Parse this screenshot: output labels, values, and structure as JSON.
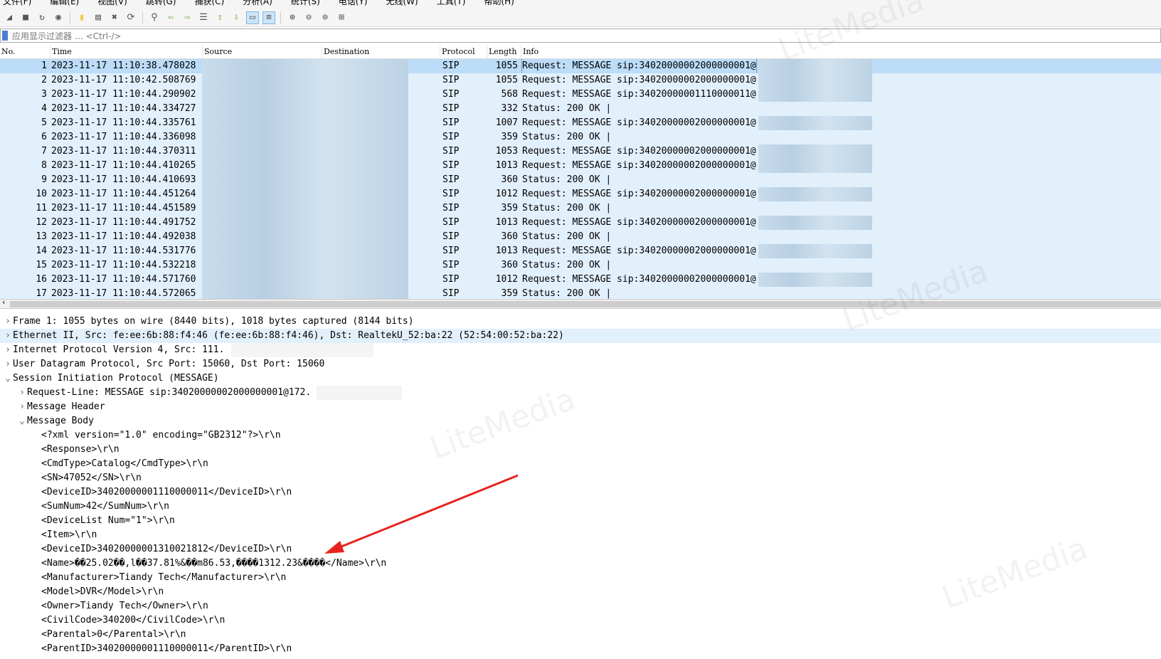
{
  "menu": [
    "文件(F)",
    "编辑(E)",
    "视图(V)",
    "跳转(G)",
    "捕获(C)",
    "分析(A)",
    "统计(S)",
    "电话(Y)",
    "无线(W)",
    "工具(T)",
    "帮助(H)"
  ],
  "toolbar": [
    "shark-fin-icon",
    "stop-icon",
    "restart-icon",
    "options-icon",
    "open-icon",
    "save-icon",
    "close-file-icon",
    "reload-icon",
    "find-icon",
    "back-icon",
    "forward-icon",
    "goto-icon",
    "first-icon",
    "last-icon",
    "autoscroll-icon",
    "colorize-icon",
    "zoom-in-icon",
    "zoom-out-icon",
    "zoom-reset-icon",
    "resize-columns-icon"
  ],
  "filter": {
    "placeholder": "应用显示过滤器 … <Ctrl-/>"
  },
  "columns": [
    "No.",
    "Time",
    "Source",
    "Destination",
    "Protocol",
    "Length",
    "Info"
  ],
  "packets": [
    {
      "no": "1",
      "time": "2023-11-17 11:10:38.478028",
      "proto": "SIP",
      "len": "1055",
      "info": "Request: MESSAGE sip:34020000002000000001@"
    },
    {
      "no": "2",
      "time": "2023-11-17 11:10:42.508769",
      "proto": "SIP",
      "len": "1055",
      "info": "Request: MESSAGE sip:34020000002000000001@"
    },
    {
      "no": "3",
      "time": "2023-11-17 11:10:44.290902",
      "proto": "SIP",
      "len": "568",
      "info": "Request: MESSAGE sip:34020000001110000011@"
    },
    {
      "no": "4",
      "time": "2023-11-17 11:10:44.334727",
      "proto": "SIP",
      "len": "332",
      "info": "Status: 200 OK |"
    },
    {
      "no": "5",
      "time": "2023-11-17 11:10:44.335761",
      "proto": "SIP",
      "len": "1007",
      "info": "Request: MESSAGE sip:34020000002000000001@"
    },
    {
      "no": "6",
      "time": "2023-11-17 11:10:44.336098",
      "proto": "SIP",
      "len": "359",
      "info": "Status: 200 OK |"
    },
    {
      "no": "7",
      "time": "2023-11-17 11:10:44.370311",
      "proto": "SIP",
      "len": "1053",
      "info": "Request: MESSAGE sip:34020000002000000001@"
    },
    {
      "no": "8",
      "time": "2023-11-17 11:10:44.410265",
      "proto": "SIP",
      "len": "1013",
      "info": "Request: MESSAGE sip:34020000002000000001@"
    },
    {
      "no": "9",
      "time": "2023-11-17 11:10:44.410693",
      "proto": "SIP",
      "len": "360",
      "info": "Status: 200 OK |"
    },
    {
      "no": "10",
      "time": "2023-11-17 11:10:44.451264",
      "proto": "SIP",
      "len": "1012",
      "info": "Request: MESSAGE sip:34020000002000000001@"
    },
    {
      "no": "11",
      "time": "2023-11-17 11:10:44.451589",
      "proto": "SIP",
      "len": "359",
      "info": "Status: 200 OK |"
    },
    {
      "no": "12",
      "time": "2023-11-17 11:10:44.491752",
      "proto": "SIP",
      "len": "1013",
      "info": "Request: MESSAGE sip:34020000002000000001@"
    },
    {
      "no": "13",
      "time": "2023-11-17 11:10:44.492038",
      "proto": "SIP",
      "len": "360",
      "info": "Status: 200 OK |"
    },
    {
      "no": "14",
      "time": "2023-11-17 11:10:44.531776",
      "proto": "SIP",
      "len": "1013",
      "info": "Request: MESSAGE sip:34020000002000000001@"
    },
    {
      "no": "15",
      "time": "2023-11-17 11:10:44.532218",
      "proto": "SIP",
      "len": "360",
      "info": "Status: 200 OK |"
    },
    {
      "no": "16",
      "time": "2023-11-17 11:10:44.571760",
      "proto": "SIP",
      "len": "1012",
      "info": "Request: MESSAGE sip:34020000002000000001@"
    },
    {
      "no": "17",
      "time": "2023-11-17 11:10:44.572065",
      "proto": "SIP",
      "len": "359",
      "info": "Status: 200 OK |"
    }
  ],
  "details": [
    {
      "indent": 0,
      "arrow": "›",
      "text": "Frame 1: 1055 bytes on wire (8440 bits), 1018 bytes captured (8144 bits)"
    },
    {
      "indent": 0,
      "arrow": "›",
      "text": "Ethernet II, Src: fe:ee:6b:88:f4:46 (fe:ee:6b:88:f4:46), Dst: RealtekU_52:ba:22 (52:54:00:52:ba:22)",
      "hl": true
    },
    {
      "indent": 0,
      "arrow": "›",
      "text": "Internet Protocol Version 4, Src: 111."
    },
    {
      "indent": 0,
      "arrow": "›",
      "text": "User Datagram Protocol, Src Port: 15060, Dst Port: 15060"
    },
    {
      "indent": 0,
      "arrow": "⌄",
      "text": "Session Initiation Protocol (MESSAGE)"
    },
    {
      "indent": 1,
      "arrow": "›",
      "text": "Request-Line: MESSAGE sip:34020000002000000001@172.            IP/2.0"
    },
    {
      "indent": 1,
      "arrow": "›",
      "text": "Message Header"
    },
    {
      "indent": 1,
      "arrow": "⌄",
      "text": "Message Body"
    },
    {
      "indent": 2,
      "arrow": "",
      "text": "<?xml version=\"1.0\" encoding=\"GB2312\"?>\\r\\n"
    },
    {
      "indent": 2,
      "arrow": "",
      "text": "<Response>\\r\\n"
    },
    {
      "indent": 2,
      "arrow": "",
      "text": "<CmdType>Catalog</CmdType>\\r\\n"
    },
    {
      "indent": 2,
      "arrow": "",
      "text": "<SN>47052</SN>\\r\\n"
    },
    {
      "indent": 2,
      "arrow": "",
      "text": "<DeviceID>34020000001110000011</DeviceID>\\r\\n"
    },
    {
      "indent": 2,
      "arrow": "",
      "text": "<SumNum>42</SumNum>\\r\\n"
    },
    {
      "indent": 2,
      "arrow": "",
      "text": "<DeviceList Num=\"1\">\\r\\n"
    },
    {
      "indent": 2,
      "arrow": "",
      "text": "<Item>\\r\\n"
    },
    {
      "indent": 2,
      "arrow": "",
      "text": "<DeviceID>34020000001310021812</DeviceID>\\r\\n"
    },
    {
      "indent": 2,
      "arrow": "",
      "text": "<Name>��25.02��,l��37.81%&��m86.53,����1312.23&����</Name>\\r\\n"
    },
    {
      "indent": 2,
      "arrow": "",
      "text": "<Manufacturer>Tiandy Tech</Manufacturer>\\r\\n"
    },
    {
      "indent": 2,
      "arrow": "",
      "text": "<Model>DVR</Model>\\r\\n"
    },
    {
      "indent": 2,
      "arrow": "",
      "text": "<Owner>Tiandy Tech</Owner>\\r\\n"
    },
    {
      "indent": 2,
      "arrow": "",
      "text": "<CivilCode>340200</CivilCode>\\r\\n"
    },
    {
      "indent": 2,
      "arrow": "",
      "text": "<Parental>0</Parental>\\r\\n"
    },
    {
      "indent": 2,
      "arrow": "",
      "text": "<ParentID>34020000001110000011</ParentID>\\r\\n"
    }
  ],
  "watermark": "LiteMedia",
  "colors": {
    "row_bg": "#e2f0fc",
    "selected_bg": "#bcdcf7",
    "annotation_arrow": "#e8231f"
  }
}
